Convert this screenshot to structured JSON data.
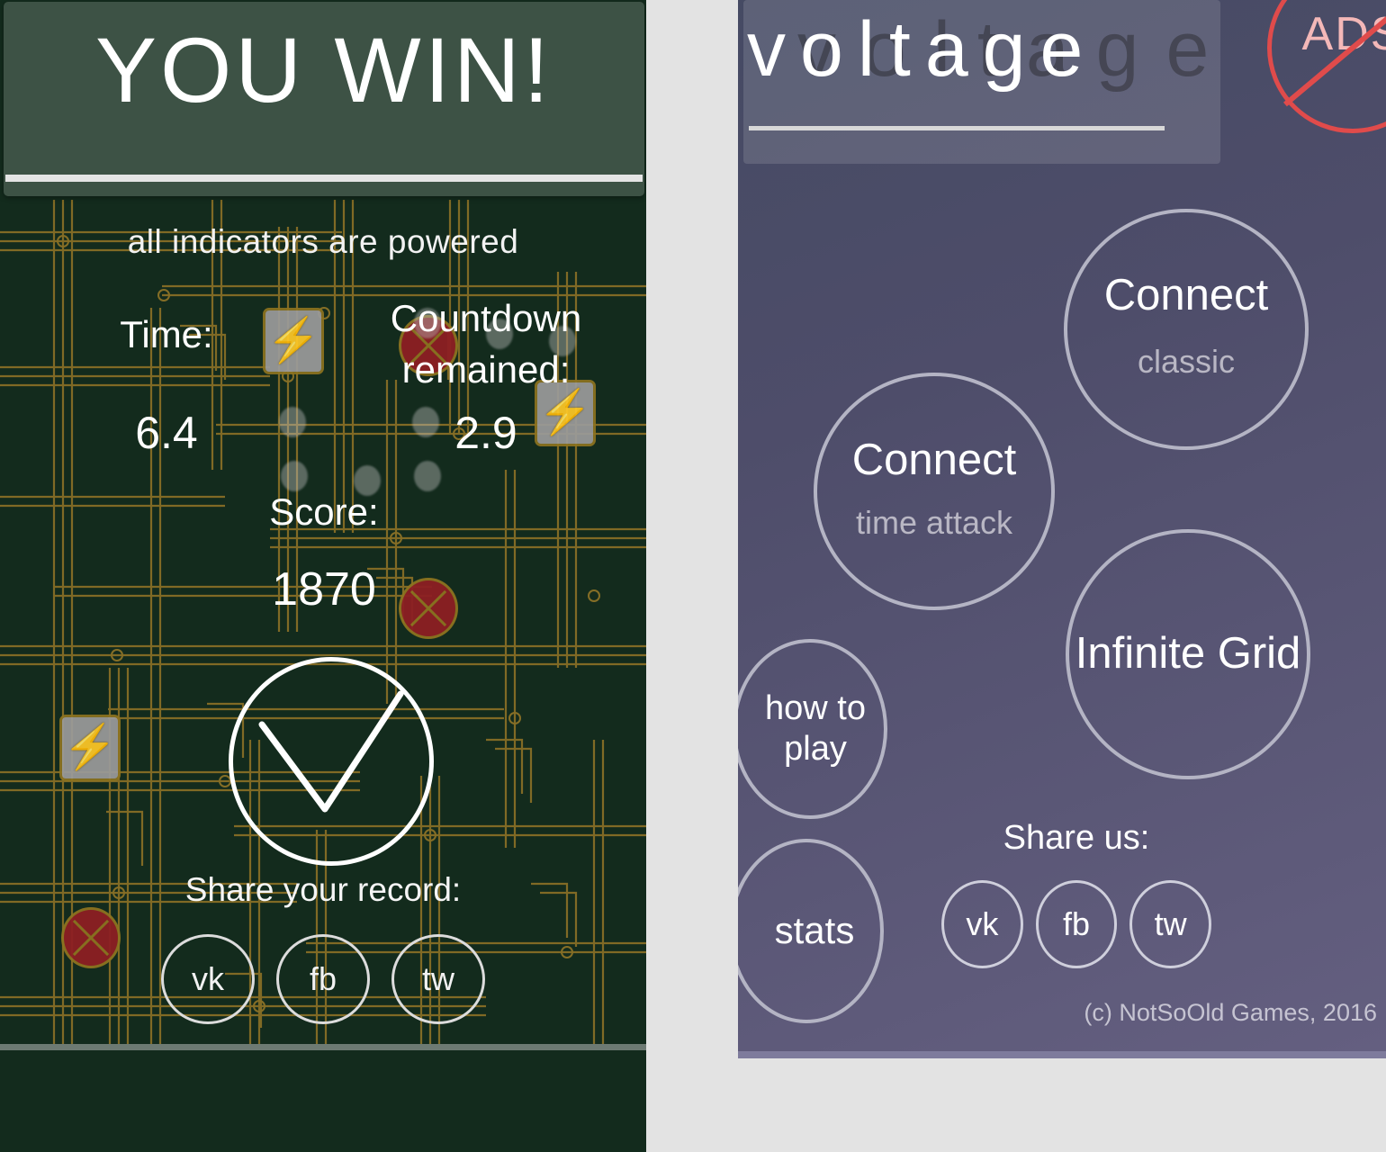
{
  "win_screen": {
    "title": "YOU WIN!",
    "subtitle": "all indicators are powered",
    "stats": {
      "time_label": "Time:",
      "time_value": "6.4",
      "countdown_label": "Countdown\nremained:",
      "countdown_value": "2.9",
      "score_label": "Score:",
      "score_value": "1870"
    },
    "ok_button_icon": "checkmark-icon",
    "share_label": "Share your record:",
    "share_buttons": [
      {
        "id": "vk",
        "label": "vk"
      },
      {
        "id": "fb",
        "label": "fb"
      },
      {
        "id": "tw",
        "label": "tw"
      }
    ],
    "colors": {
      "background": "#132b1d",
      "header": "#3d5245",
      "circuit_trace": "#9a7a28",
      "indicator_red": "#8d1f23",
      "bolt_gold": "#c9920f"
    }
  },
  "menu_screen": {
    "title": "voltage",
    "title_ghost": "voltage",
    "no_ads_badge": "ADS",
    "buttons": [
      {
        "id": "connect-classic",
        "main": "Connect",
        "sub": "classic"
      },
      {
        "id": "connect-time-attack",
        "main": "Connect",
        "sub": "time attack"
      },
      {
        "id": "infinite-grid",
        "main": "Infinite Grid",
        "sub": ""
      },
      {
        "id": "how-to-play",
        "main": "how to\nplay",
        "sub": ""
      },
      {
        "id": "stats",
        "main": "stats",
        "sub": ""
      }
    ],
    "share_label": "Share us:",
    "share_buttons": [
      {
        "id": "vk",
        "label": "vk"
      },
      {
        "id": "fb",
        "label": "fb"
      },
      {
        "id": "tw",
        "label": "tw"
      }
    ],
    "copyright": "(c) NotSoOld Games, 2016",
    "colors": {
      "background_top": "#454a63",
      "background_bottom": "#645f80",
      "accent_red": "#e04b4b",
      "outline": "#b4b4c4"
    }
  },
  "page": {
    "gap_color": "#e3e3e3"
  }
}
